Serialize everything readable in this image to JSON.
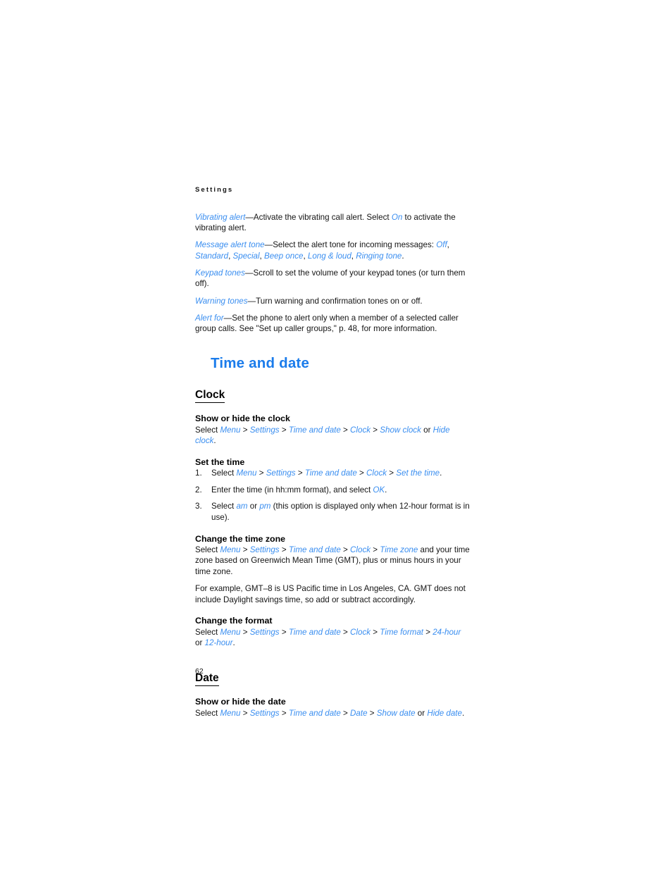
{
  "page": {
    "running_header": "Settings",
    "folio": "62",
    "accent_heading_color": "#1b7ceb",
    "link_color": "#3a8ef0",
    "text_color": "#141414"
  },
  "settings_list": {
    "vibrating_alert": {
      "term": "Vibrating alert",
      "dash": "—",
      "text_1": "Activate the vibrating call alert. Select ",
      "value_on": "On",
      "text_2": " to activate the vibrating alert."
    },
    "message_alert_tone": {
      "term": "Message alert tone",
      "dash": "—",
      "text_1": "Select the alert tone for incoming messages: ",
      "values": [
        "Off",
        "Standard",
        "Special",
        "Beep once",
        "Long & loud",
        "Ringing tone"
      ],
      "end": "."
    },
    "keypad_tones": {
      "term": "Keypad tones",
      "dash": "—",
      "text_1": "Scroll to set the volume of your keypad tones (or turn them off)."
    },
    "warning_tones": {
      "term": "Warning tones",
      "dash": "—",
      "text_1": "Turn warning and confirmation tones on or off."
    },
    "alert_for": {
      "term": "Alert for",
      "dash": "—",
      "text_1": "Set the phone to alert only when a member of a selected caller group calls. See \"Set up caller groups,\" p. 48, for more information."
    }
  },
  "chapter": {
    "title": "Time and date"
  },
  "clock": {
    "heading": "Clock",
    "show_hide": {
      "heading": "Show or hide the clock",
      "select_label": "Select ",
      "path": [
        "Menu",
        "Settings",
        "Time and date",
        "Clock",
        "Show clock"
      ],
      "or": " or ",
      "alt": "Hide clock",
      "end": "."
    },
    "set_time": {
      "heading": "Set the time",
      "steps": [
        {
          "num": "1.",
          "select_label": "Select ",
          "path": [
            "Menu",
            "Settings",
            "Time and date",
            "Clock",
            "Set the time"
          ],
          "end": "."
        },
        {
          "num": "2.",
          "text_1": "Enter the time (in hh:mm format), and select ",
          "value": "OK",
          "end": "."
        },
        {
          "num": "3.",
          "text_1": "Select ",
          "value_a": "am",
          "mid": " or ",
          "value_b": "pm",
          "text_2": " (this option is displayed only when 12-hour format is in use)."
        }
      ]
    },
    "time_zone": {
      "heading": "Change the time zone",
      "select_label": "Select ",
      "path": [
        "Menu",
        "Settings",
        "Time and date",
        "Clock",
        "Time zone"
      ],
      "text_after": " and your time zone based on Greenwich Mean Time (GMT), plus or minus hours in your time zone.",
      "example": "For example, GMT–8 is US Pacific time in Los Angeles, CA. GMT does not include Daylight savings time, so add or subtract accordingly."
    },
    "format": {
      "heading": "Change the format",
      "select_label": "Select ",
      "path": [
        "Menu",
        "Settings",
        "Time and date",
        "Clock",
        "Time format",
        "24-hour"
      ],
      "or": " or ",
      "alt": "12-hour",
      "end": "."
    }
  },
  "date": {
    "heading": "Date",
    "show_hide": {
      "heading": "Show or hide the date",
      "select_label": "Select ",
      "path": [
        "Menu",
        "Settings",
        "Time and date",
        "Date",
        "Show date"
      ],
      "or": " or ",
      "alt": "Hide date",
      "end": "."
    }
  }
}
